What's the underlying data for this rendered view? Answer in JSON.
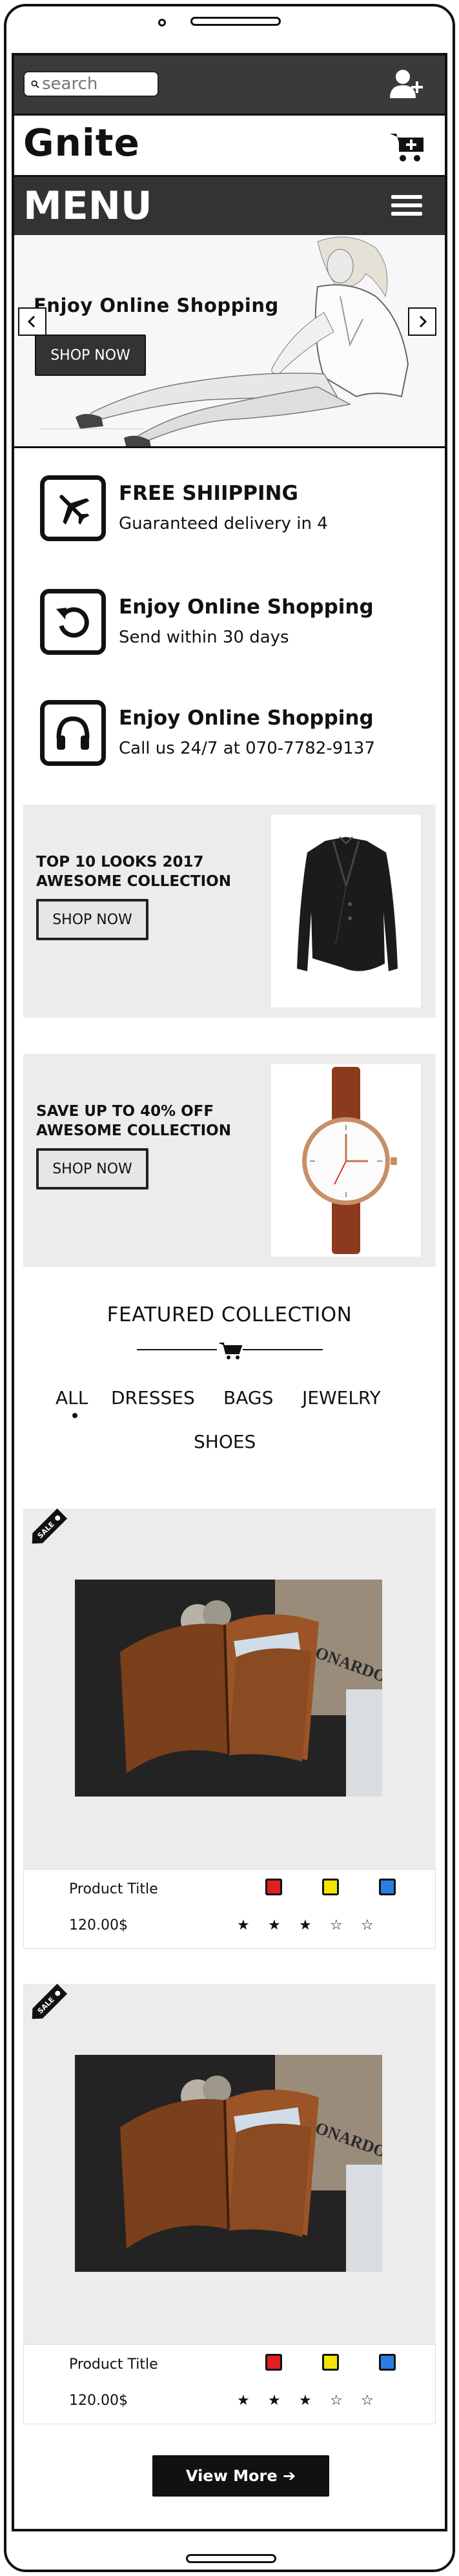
{
  "topbar": {
    "search_placeholder": "search",
    "user_icon": "user-plus-icon"
  },
  "brand": {
    "name": "Gnite",
    "cart_icon": "cart-plus-icon"
  },
  "menu": {
    "label": "MENU",
    "icon": "hamburger-icon"
  },
  "hero": {
    "title": "Enjoy Online Shopping",
    "button": "SHOP NOW",
    "prev_icon": "chevron-left-icon",
    "next_icon": "chevron-right-icon"
  },
  "features": [
    {
      "icon": "airplane-icon",
      "title": "FREE SHIIPPING",
      "subtitle": "Guaranteed delivery in 4"
    },
    {
      "icon": "undo-icon",
      "title": "Enjoy Online Shopping",
      "subtitle": "Send within 30 days"
    },
    {
      "icon": "headphones-icon",
      "title": "Enjoy Online Shopping",
      "subtitle": "Call us 24/7 at 070-7782-9137"
    }
  ],
  "promos": [
    {
      "line1": "TOP 10 LOOKS 2017",
      "line2": "AWESOME COLLECTION",
      "button": "SHOP NOW",
      "image": "blazer"
    },
    {
      "line1": "SAVE UP TO 40% OFF",
      "line2": "AWESOME COLLECTION",
      "button": "SHOP NOW",
      "image": "watch"
    }
  ],
  "featured": {
    "title": "FEATURED COLLECTION",
    "tabs": [
      "ALL",
      "DRESSES",
      "BAGS",
      "JEWELRY",
      "SHOES"
    ],
    "active_tab": "ALL"
  },
  "products": [
    {
      "badge": "SALE",
      "title": "Product Title",
      "price": "120.00$",
      "swatches": [
        "#e02020",
        "#f5e400",
        "#2a7de1"
      ],
      "rating": 3,
      "max_rating": 5,
      "image": "leather-wallet"
    },
    {
      "badge": "SALE",
      "title": "Product Title",
      "price": "120.00$",
      "swatches": [
        "#e02020",
        "#f5e400",
        "#2a7de1"
      ],
      "rating": 3,
      "max_rating": 5,
      "image": "leather-wallet"
    }
  ],
  "view_more": "View More ➔",
  "wallet_brand": "LEONARDO"
}
